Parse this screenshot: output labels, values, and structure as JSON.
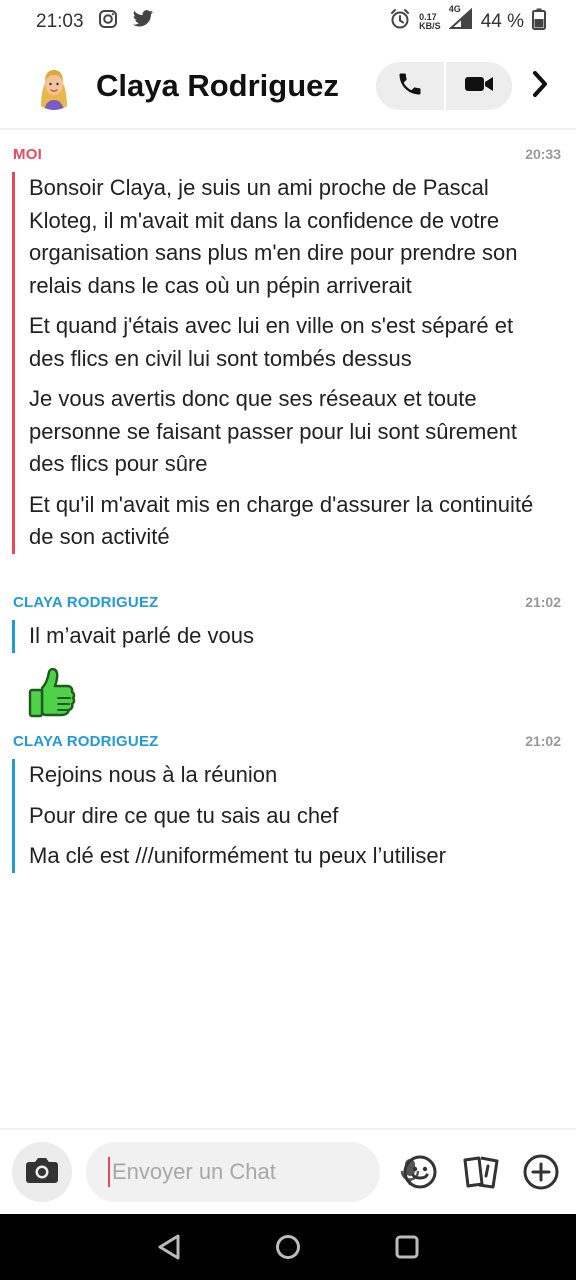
{
  "status_bar": {
    "time": "21:03",
    "netspeed_value": "0.17",
    "netspeed_unit": "KB/S",
    "network": "4G",
    "battery": "44 %",
    "icons": [
      "instagram-icon",
      "twitter-icon",
      "alarm-icon",
      "signal-icon",
      "battery-icon"
    ]
  },
  "header": {
    "contact_name": "Claya Rodriguez",
    "icons": [
      "avatar",
      "phone-icon",
      "video-icon",
      "chevron-right-icon"
    ]
  },
  "messages": [
    {
      "sender": "MOI",
      "time": "20:33",
      "texts": [
        "Bonsoir Claya, je suis un ami proche de Pascal Kloteg, il m'avait mit dans la confidence de votre organisation sans plus m'en dire pour prendre son relais dans le cas où un pépin arriverait",
        "Et quand j'étais avec lui en ville on s'est séparé et des flics en civil lui sont tombés dessus",
        "Je vous avertis donc que ses réseaux et toute personne se faisant passer pour lui sont sûrement des flics pour sûre",
        "Et qu'il m'avait mis en charge d'assurer la continuité de son activité"
      ]
    },
    {
      "sender": "CLAYA RODRIGUEZ",
      "time": "21:02",
      "texts": [
        "Il m’avait parlé de vous"
      ],
      "reaction": "thumbs-up-icon"
    },
    {
      "sender": "CLAYA RODRIGUEZ",
      "time": "21:02",
      "texts": [
        "Rejoins nous à la réunion",
        "Pour dire ce que tu sais au chef",
        "Ma clé est ///uniformément tu peux l’utiliser"
      ]
    }
  ],
  "composer": {
    "placeholder": "Envoyer un Chat",
    "icons": [
      "camera-icon",
      "mic-icon",
      "emoji-icon",
      "cards-icon",
      "plus-icon"
    ]
  },
  "nav": {
    "icons": [
      "back-icon",
      "home-icon",
      "recents-icon"
    ]
  },
  "colors": {
    "me": "#e8495a",
    "them": "#1f9bd6",
    "thumb": "#4fd14a"
  }
}
